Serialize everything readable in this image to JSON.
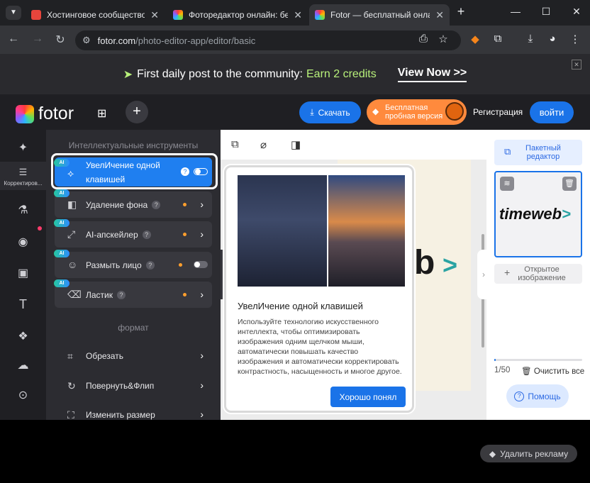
{
  "browser": {
    "tabs": [
      {
        "title": "Хостинговое сообщество «Т",
        "favicon_color": "#e8453c",
        "active": false
      },
      {
        "title": "Фоторедактор онлайн: бесп",
        "favicon_color": "#ff7a00",
        "active": false
      },
      {
        "title": "Fotor — бесплатный онлайн",
        "favicon_color": "#ff7a00",
        "active": true
      }
    ],
    "new_tab": "+",
    "url_host": "fotor.com",
    "url_path": "/photo-editor-app/editor/basic"
  },
  "banner": {
    "text": "First daily post to the community:",
    "highlight": "Earn 2 credits",
    "cta": "View Now >>"
  },
  "header": {
    "logo": "fotor",
    "save": "Скачать",
    "trial_line1": "Бесплатная",
    "trial_line2": "пробная версия",
    "register": "Регистрация",
    "login": "войти"
  },
  "rail": {
    "active_label": "Корректиров..."
  },
  "panel": {
    "section_ai": "Интеллектуальные инструменты",
    "ai_badge": "AI",
    "tools": [
      {
        "label_line1": "УвелИчение одной",
        "label_line2": "клавишей"
      },
      {
        "label": "Удаление фона"
      },
      {
        "label": "AI-апскейлер"
      },
      {
        "label": "Размыть лицо"
      },
      {
        "label": "Ластик"
      }
    ],
    "section_format": "формат",
    "format_items": [
      "Обрезать",
      "Повернуть&Флип",
      "Изменить размер"
    ]
  },
  "tooltip": {
    "title": "УвелИчение одной клавишей",
    "body": "Используйте технологию искусственного интеллекта, чтобы оптимизировать изображения одним щелчком мыши, автоматически повышать качество изображения и автоматически корректировать контрастность, насыщенность и многое другое.",
    "button": "Хорошо понял"
  },
  "canvas": {
    "partial_text": "b",
    "partial_arrow": ">"
  },
  "right": {
    "batch_line1": "Пакетный",
    "batch_line2": "редактор",
    "thumb_text": "timeweb",
    "thumb_arrow": ">",
    "open_line1": "Открытое",
    "open_line2": "изображение",
    "count": "1/50",
    "progress": 0.02,
    "clear": "Очистить все",
    "help": "Помощь"
  },
  "ads": {
    "remove": "Удалить рекламу"
  },
  "colors": {
    "accent": "#1a73e8",
    "trial": "#ff8a3d",
    "ai_dot": "#ff9f2d"
  }
}
